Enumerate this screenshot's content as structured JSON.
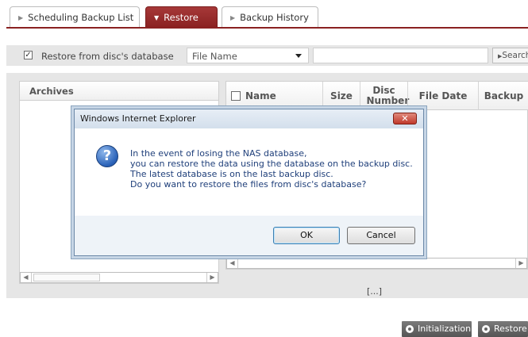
{
  "tabs": [
    {
      "label": "Scheduling Backup List",
      "active": false
    },
    {
      "label": "Restore",
      "active": true
    },
    {
      "label": "Backup History",
      "active": false
    }
  ],
  "filter": {
    "checkbox_label": "Restore from disc's database",
    "checked": true,
    "select_value": "File Name",
    "search_value": "",
    "search_button": "Search"
  },
  "archives": {
    "header": "Archives"
  },
  "files": {
    "columns": [
      "Name",
      "Size",
      "Disc Number",
      "File Date",
      "Backup"
    ],
    "pager_text": "[...]"
  },
  "buttons": {
    "initialization": "Initialization",
    "restore": "Restore"
  },
  "dialog": {
    "title": "Windows Internet Explorer",
    "close_symbol": "✕",
    "icon_symbol": "?",
    "lines": [
      "In the event of losing the NAS database,",
      "you can restore the data using the database on the backup disc.",
      "The latest database is on the last backup disc.",
      "Do you want to restore the files from disc's database?"
    ],
    "ok": "OK",
    "cancel": "Cancel"
  },
  "colors": {
    "accent": "#8a2121",
    "dialog_text": "#1f3f7a"
  }
}
